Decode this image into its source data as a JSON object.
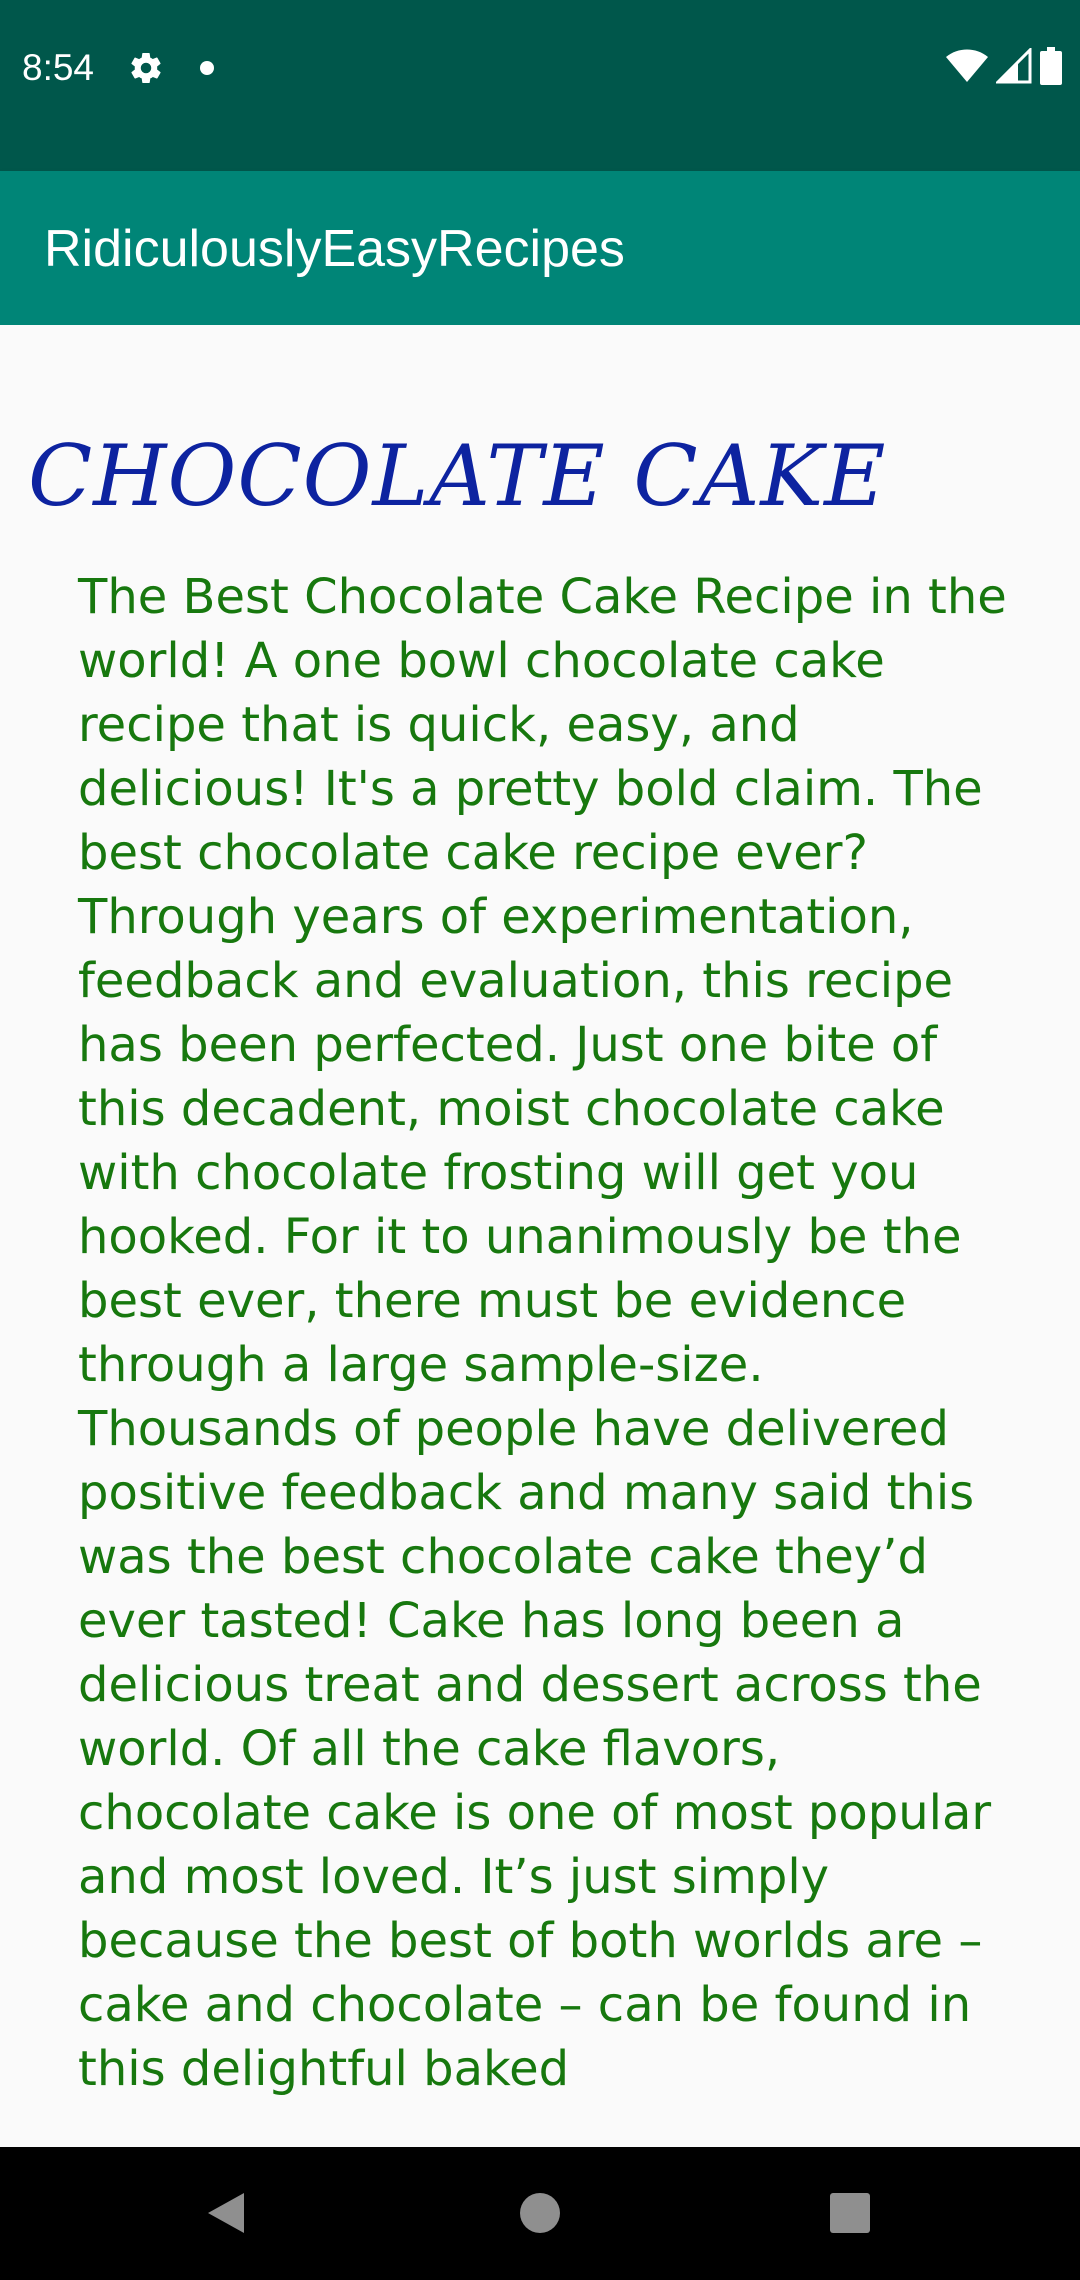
{
  "status_bar": {
    "time": "8:54",
    "icons": [
      "gear-icon",
      "notification-dot-icon",
      "wifi-icon",
      "signal-icon",
      "battery-icon"
    ]
  },
  "app_bar": {
    "title": "RidiculouslyEasyRecipes"
  },
  "recipe": {
    "title": "CHOCOLATE CAKE",
    "description": "The Best Chocolate Cake Recipe in the world! A one bowl chocolate cake recipe that is quick, easy, and delicious! It's a pretty bold claim. The best chocolate cake recipe ever? Through years of experimentation, feedback and evaluation, this recipe has been perfected. Just one bite of this decadent, moist chocolate cake with chocolate frosting will get you hooked. For it to unanimously be the best ever, there must be evidence through a large sample-size. Thousands of people have delivered positive feedback and many said this was the best chocolate cake they’d ever tasted! Cake has long been a delicious treat and dessert across the world. Of all the cake flavors, chocolate cake is one of most popular and most loved. It’s just simply because the best of both worlds are – cake and chocolate – can be found in this delightful baked"
  },
  "nav_bar": {
    "buttons": [
      "back-icon",
      "home-icon",
      "recents-icon"
    ]
  },
  "colors": {
    "status_bar": "#00574b",
    "app_bar": "#008577",
    "title_text": "#0d23a0",
    "body_text": "#17780e",
    "background": "#fafafa"
  }
}
